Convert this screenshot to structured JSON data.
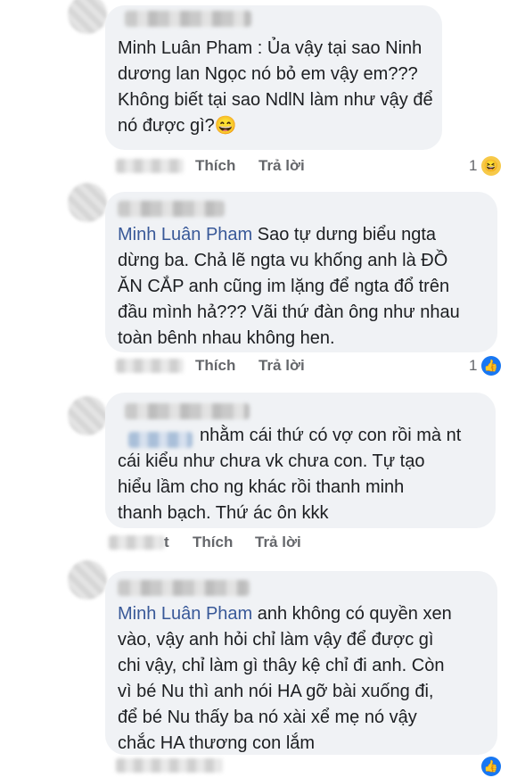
{
  "actions": {
    "like": "Thích",
    "reply": "Trả lời"
  },
  "comments": [
    {
      "author": "Minh Luân Pham",
      "text": "Minh Luân Pham : Ủa vậy tại sao Ninh\ndương lan Ngọc nó bỏ em vậy em???\nKhông biết tại sao NdlN làm như vậy để\nnó được gì?😄",
      "reaction_count": "1",
      "reaction_icon": "haha-icon"
    },
    {
      "author": "Minh Luân Pham",
      "text": " Sao tự dưng biểu ngta\ndừng ba. Chả lẽ ngta vu khống anh là ĐỒ\nĂN CẮP anh cũng im lặng để ngta đổ trên\nđầu mình hả??? Vãi thứ đàn ông như nhau\ntoàn bênh nhau không hen.",
      "reaction_count": "1",
      "reaction_icon": "like-icon"
    },
    {
      "text": "nhằm cái thứ có vợ con rồi mà nt\ncái kiểu như chưa vk chưa con. Tự tạo\nhiểu lầm cho ng khác rồi thanh minh\nthanh bạch.  Thứ ác ôn kkk",
      "time_fragment": "t"
    },
    {
      "author": "Minh Luân Pham",
      "text": " anh không có quyền xen\nvào, vậy anh hỏi chỉ làm vậy để được gì\nchi vậy, chỉ làm gì thây kệ chỉ đi anh. Còn\nvì bé Nu thì anh nói HA gỡ bài xuống đi,\nđể bé Nu thấy ba nó xài xể mẹ nó vậy\nchắc HA thương con lắm",
      "reaction_icon": "like-icon"
    }
  ],
  "colors": {
    "bubble": "#f0f2f5",
    "author": "#385898",
    "meta": "#65676b",
    "like_blue": "#1877f2"
  }
}
